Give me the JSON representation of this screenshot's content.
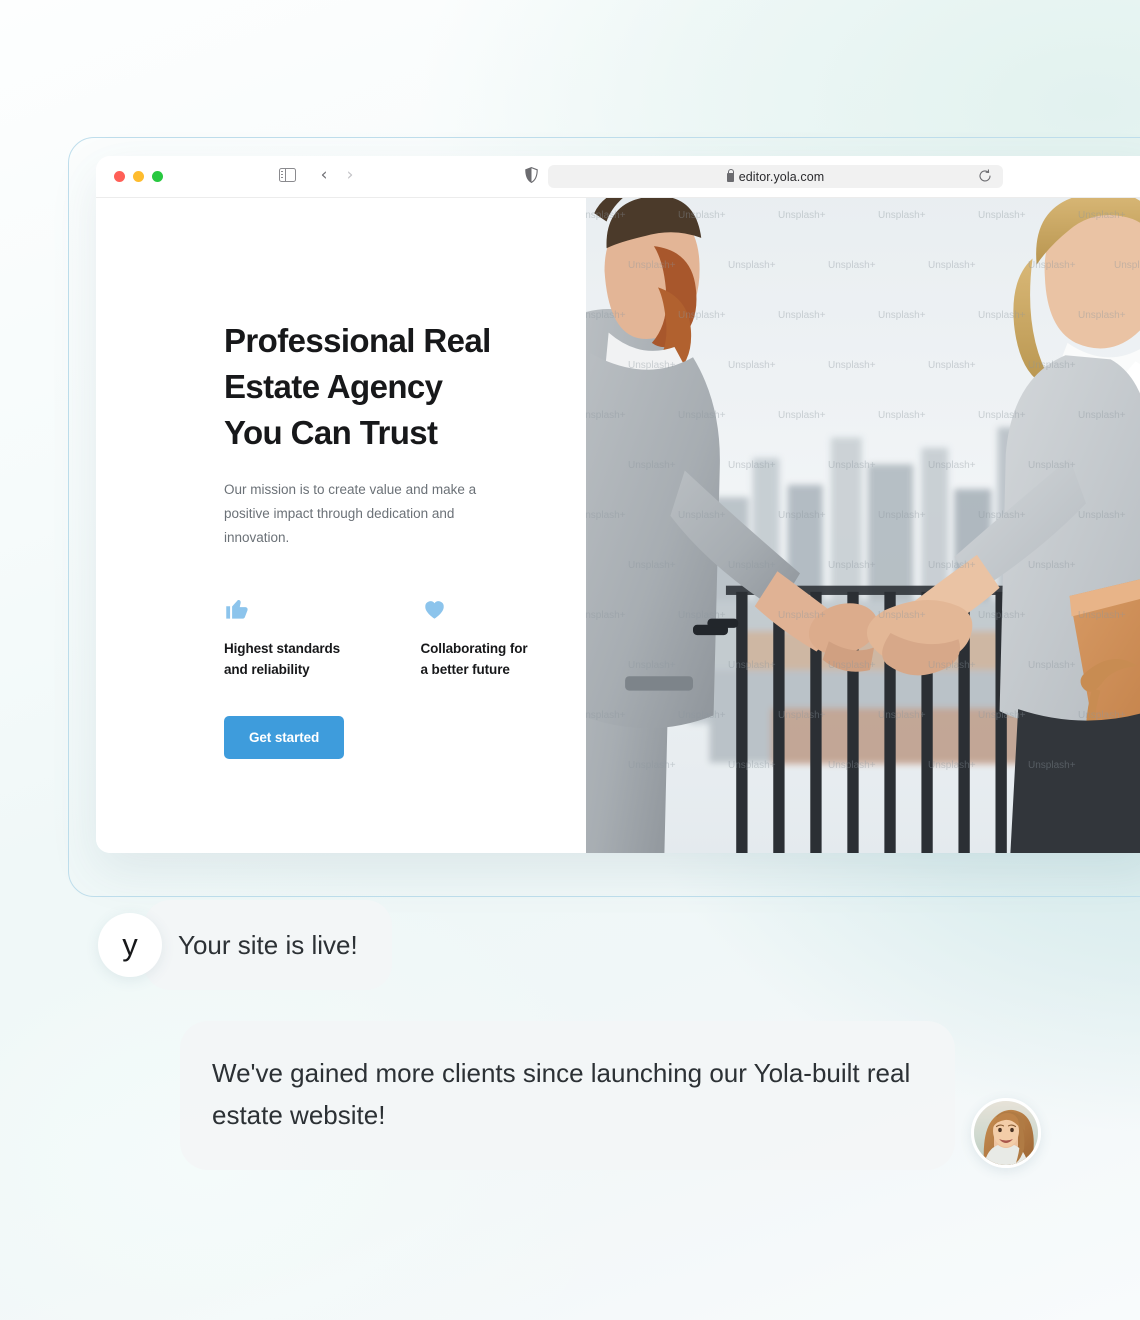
{
  "browser": {
    "url": "editor.yola.com",
    "lock_icon": "lock-icon",
    "reload_icon": "reload-icon",
    "shield_icon": "shield-icon",
    "sidebar_icon": "sidebar-toggle-icon",
    "back_icon": "‹",
    "forward_icon": "›",
    "traffic_lights": [
      "close-red",
      "minimize-yellow",
      "maximize-green"
    ]
  },
  "hero": {
    "title_lines": [
      "Professional Real",
      "Estate Agency",
      "You Can Trust"
    ],
    "title": "Professional Real Estate Agency You Can Trust",
    "subtitle": "Our mission is to create value and make a positive impact through dedication and innovation.",
    "features": [
      {
        "icon": "thumbs-up-icon",
        "label_lines": [
          "Highest standards",
          "and reliability"
        ],
        "label": "Highest standards and reliability"
      },
      {
        "icon": "heart-icon",
        "label_lines": [
          "Collaborating for",
          "a better future"
        ],
        "label": "Collaborating for a better future"
      }
    ],
    "cta_label": "Get started",
    "photo": {
      "alt": "Two business people shaking hands on a rooftop terrace with a city skyline",
      "watermark_text": "Unsplash+"
    }
  },
  "chat": {
    "messages": [
      {
        "avatar_letter": "y",
        "avatar_type": "brand-logo",
        "text": "Your site is live!"
      },
      {
        "avatar_type": "person-photo",
        "text": "We've gained more clients since launching our Yola-built real estate website!"
      }
    ]
  },
  "colors": {
    "accent_blue": "#3e9cdc",
    "icon_blue": "#8cc4ec",
    "heading": "#17181a",
    "body_text": "#6b7177",
    "bubble_bg": "#f3f5f6",
    "frame_border": "#bfdeec"
  }
}
